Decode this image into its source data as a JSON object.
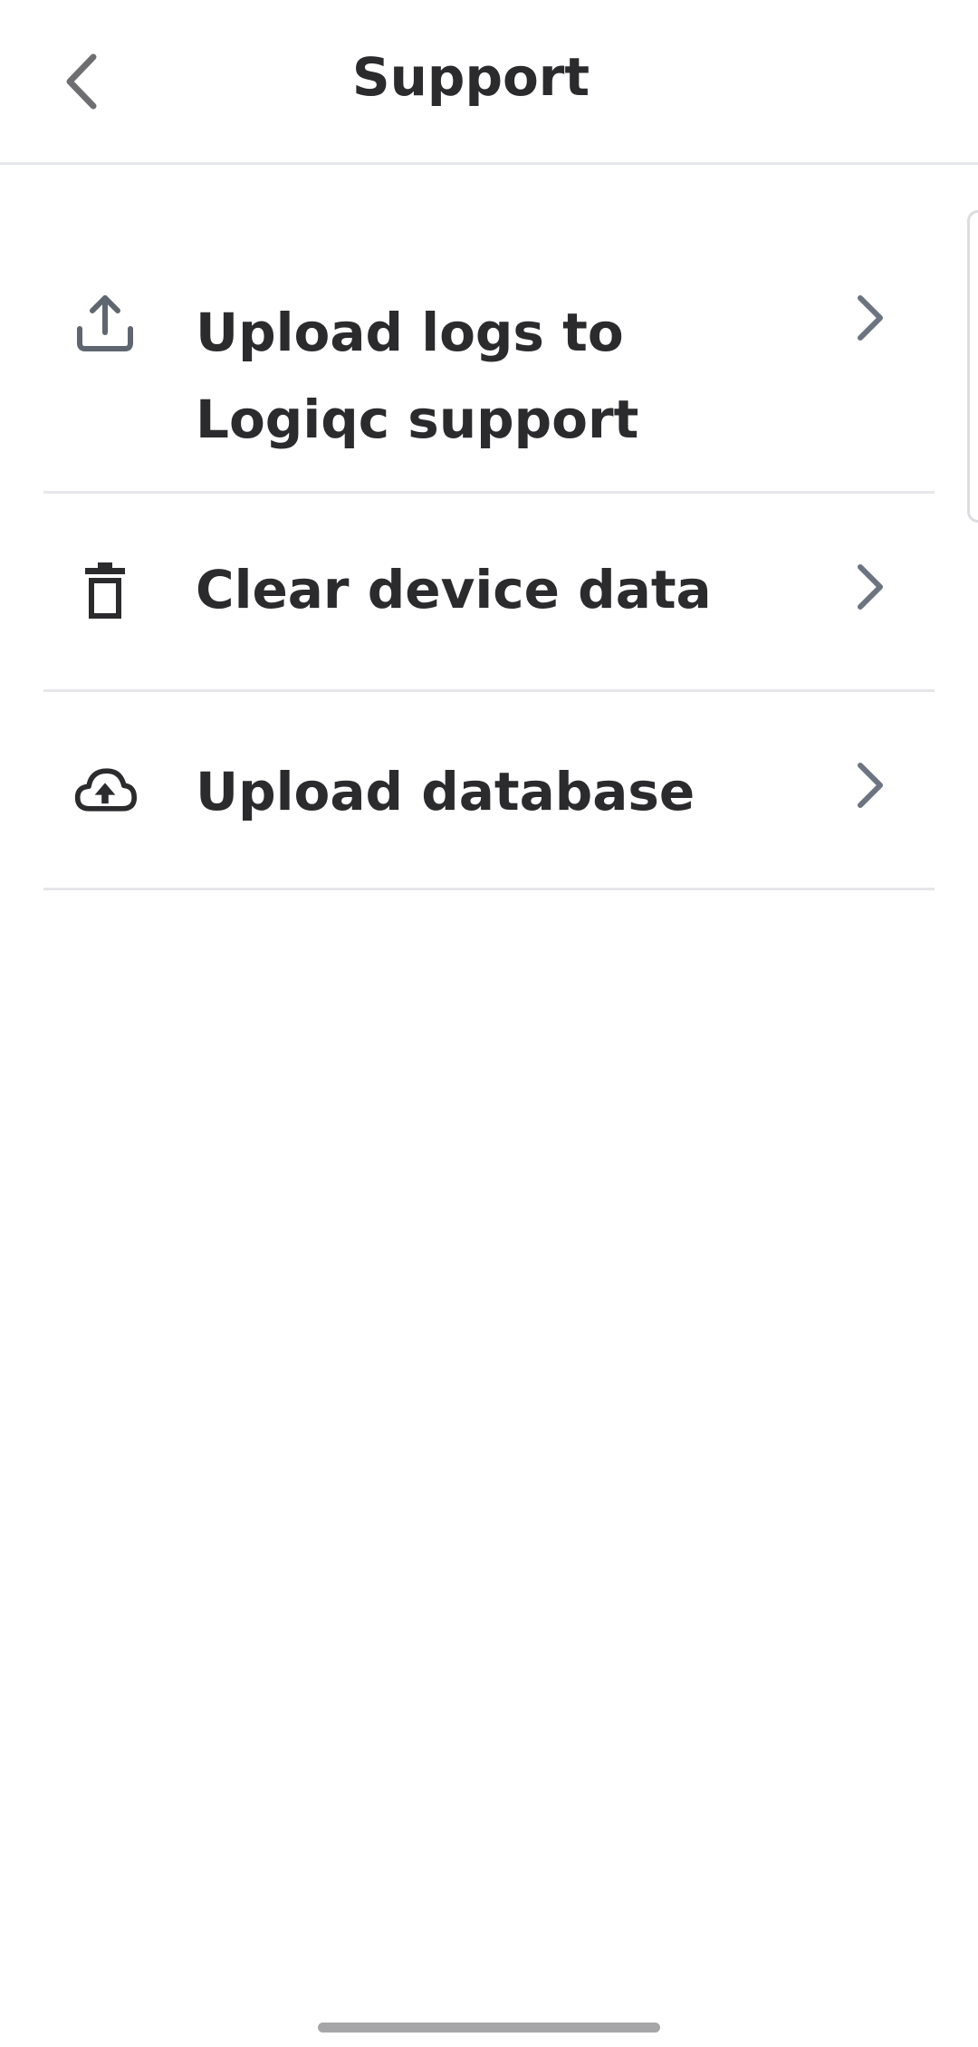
{
  "header": {
    "title": "Support",
    "back_icon": "chevron-left-icon"
  },
  "items": [
    {
      "label": "Upload logs to Logiqc support",
      "icon": "upload-icon"
    },
    {
      "label": "Clear device data",
      "icon": "trash-icon"
    },
    {
      "label": "Upload database",
      "icon": "cloud-upload-icon"
    }
  ],
  "colors": {
    "text": "#2b2b2e",
    "icon_gray": "#5f6670",
    "chevron": "#6b7480",
    "divider": "#e6e7ea",
    "background": "#ffffff"
  }
}
